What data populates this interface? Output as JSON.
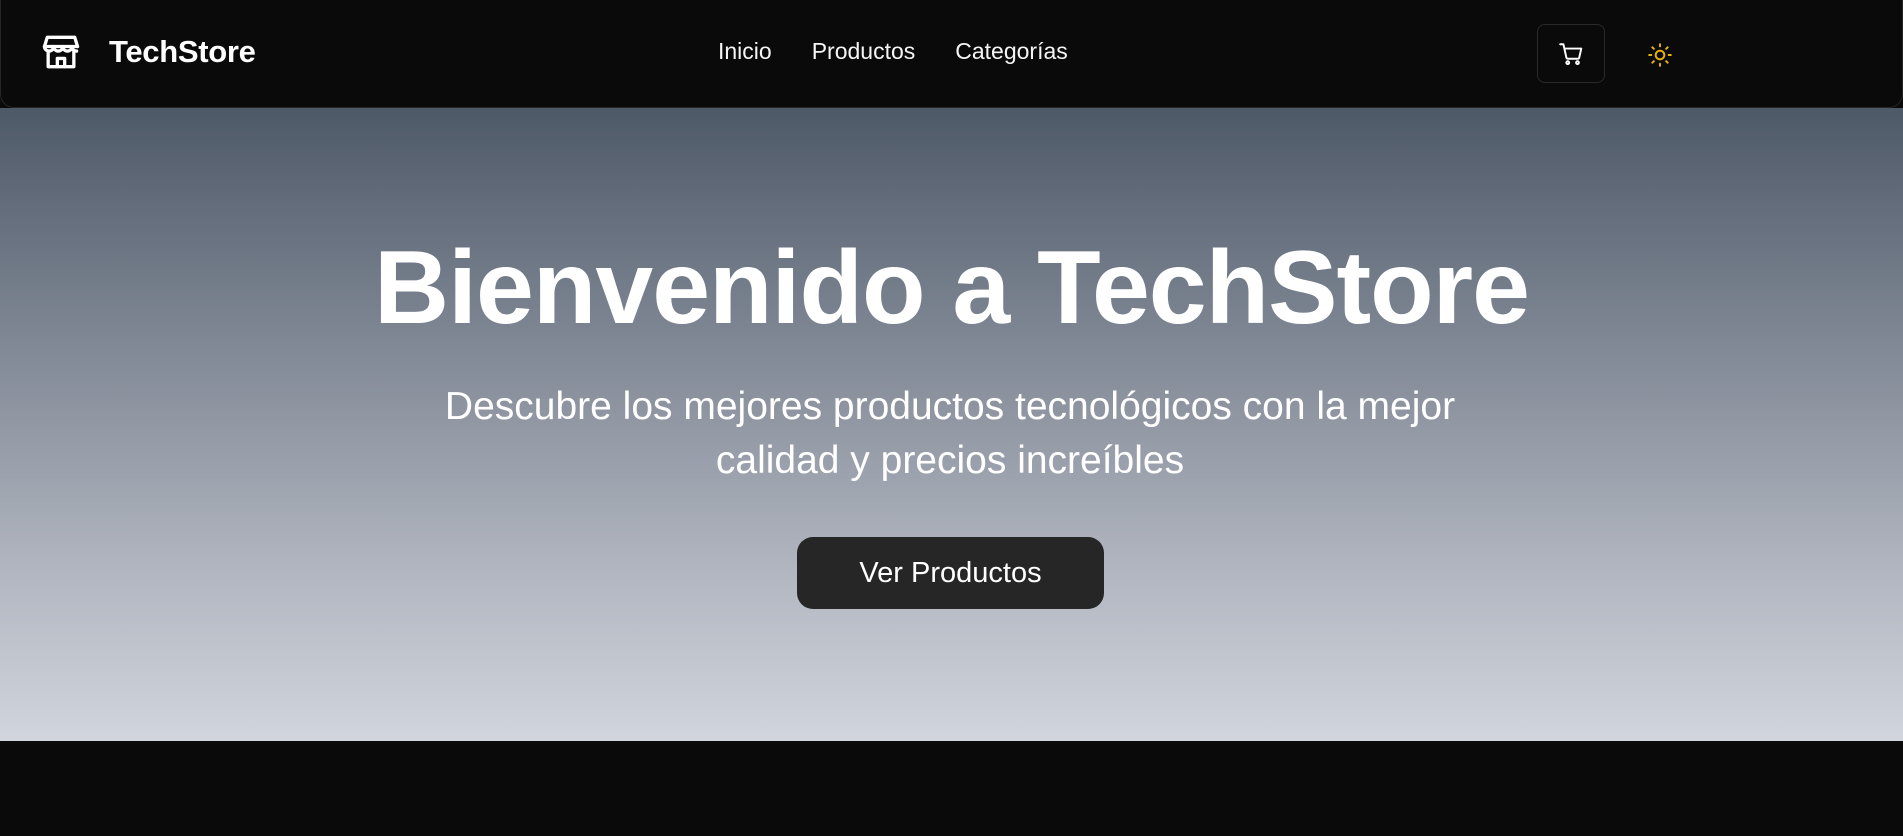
{
  "brand": {
    "name": "TechStore",
    "icon": "store-icon"
  },
  "nav": {
    "items": [
      {
        "label": "Inicio"
      },
      {
        "label": "Productos"
      },
      {
        "label": "Categorías"
      }
    ]
  },
  "header_actions": {
    "cart_icon": "shopping-cart-icon",
    "theme_icon": "sun-icon",
    "theme_icon_color": "#eab308"
  },
  "hero": {
    "title": "Bienvenido a TechStore",
    "subtitle": "Descubre los mejores productos tecnológicos con la mejor calidad y precios increíbles",
    "cta_label": "Ver Productos"
  },
  "colors": {
    "background": "#0a0a0a",
    "hero_gradient_top": "#4e5968",
    "hero_gradient_bottom": "#d1d5dd",
    "cta_background": "#262626"
  }
}
